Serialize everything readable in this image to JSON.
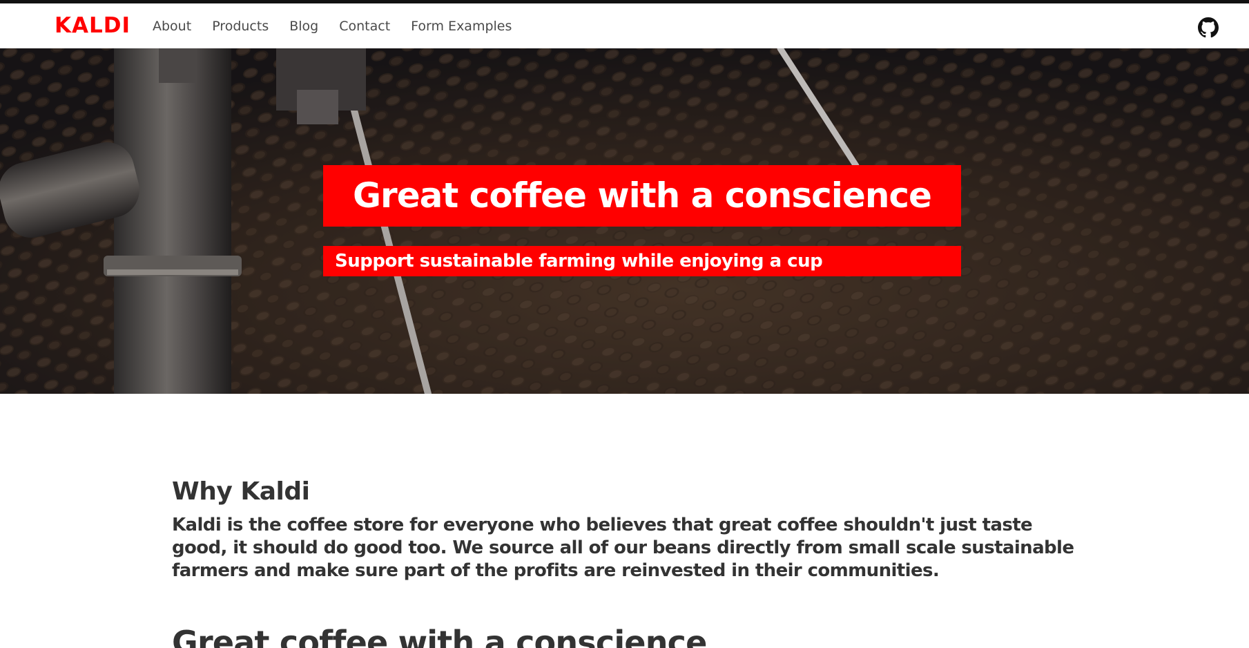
{
  "navbar": {
    "brand": "KALDI",
    "links": [
      "About",
      "Products",
      "Blog",
      "Contact",
      "Form Examples"
    ],
    "github_icon": "github-icon"
  },
  "hero": {
    "title": "Great coffee with a conscience",
    "subtitle": "Support sustainable farming while enjoying a cup"
  },
  "content": {
    "heading": "Why Kaldi",
    "description": "Kaldi is the coffee store for everyone who believes that great coffee shouldn't just taste good, it should do good too. We source all of our beans directly from small scale sustainable farmers and make sure part of the profits are reinvested in their communities.",
    "next_heading": "Great coffee with a conscience"
  },
  "colors": {
    "accent": "#ff0000",
    "text": "#333333",
    "nav_text": "#4a4a4a"
  }
}
